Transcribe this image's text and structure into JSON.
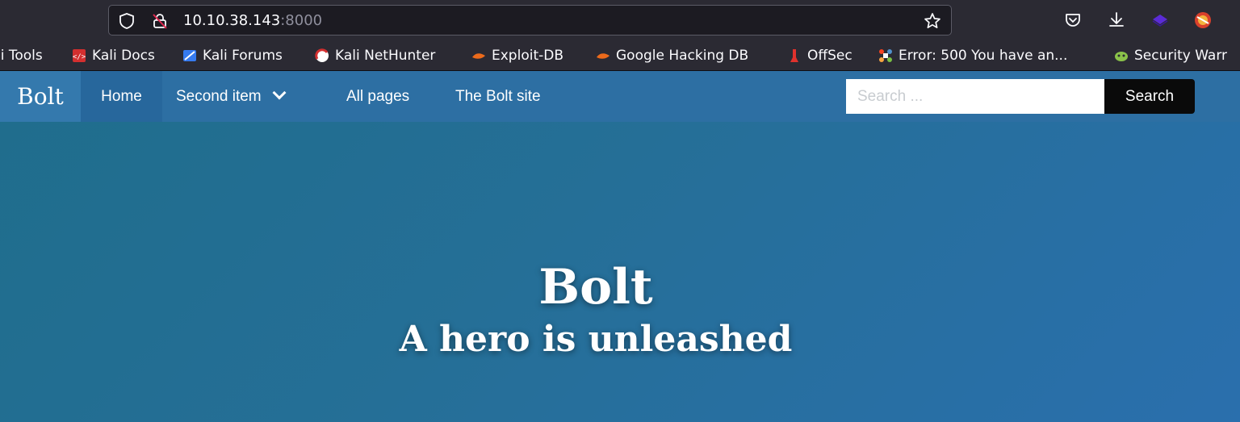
{
  "browser": {
    "url_host": "10.10.38.143",
    "url_port": ":8000",
    "icons": [
      "shield-icon",
      "insecure-lock-icon",
      "star-icon",
      "pocket-icon",
      "download-icon",
      "extension-icon",
      "profile-icon"
    ]
  },
  "bookmarks": [
    {
      "label": "li Tools",
      "icon": "kali-tools-icon"
    },
    {
      "label": "Kali Docs",
      "icon": "kali-docs-icon"
    },
    {
      "label": "Kali Forums",
      "icon": "kali-forums-icon"
    },
    {
      "label": "Kali NetHunter",
      "icon": "kali-nethunter-icon"
    },
    {
      "label": "Exploit-DB",
      "icon": "exploit-db-icon"
    },
    {
      "label": "Google Hacking DB",
      "icon": "ghdb-icon"
    },
    {
      "label": "OffSec",
      "icon": "offsec-icon"
    },
    {
      "label": "Error: 500 You have an...",
      "icon": "joomla-icon"
    },
    {
      "label": "Security Warr",
      "icon": "security-warning-icon"
    }
  ],
  "site": {
    "brand": "Bolt",
    "nav": [
      {
        "label": "Home",
        "active": true
      },
      {
        "label": "Second item",
        "has_dropdown": true
      },
      {
        "label": "All pages"
      },
      {
        "label": "The Bolt site"
      }
    ],
    "search": {
      "placeholder": "Search ...",
      "value": "",
      "button": "Search"
    },
    "hero": {
      "title": "Bolt",
      "subtitle": "A hero is unleashed"
    },
    "colors": {
      "navbar": "#2d6fa3",
      "hero_start": "#1f6d8c",
      "hero_end": "#2a6fad",
      "search_button": "#0a0a0a"
    }
  }
}
